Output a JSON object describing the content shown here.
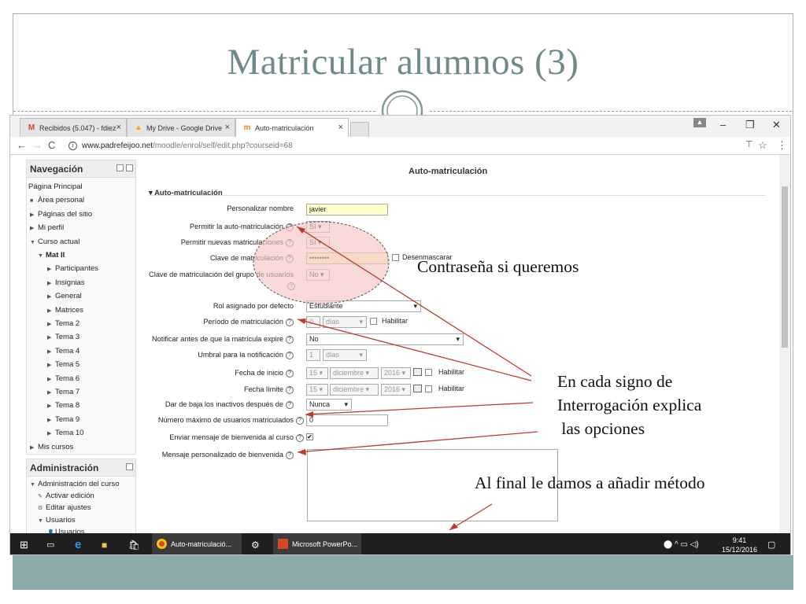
{
  "slide": {
    "title": "Matricular alumnos (3)"
  },
  "browser": {
    "tabs": [
      {
        "label": "Recibidos (5.047) - fdiez",
        "icon": "gmail-icon"
      },
      {
        "label": "My Drive - Google Drive",
        "icon": "google-drive-icon"
      },
      {
        "label": "Auto-matriculación",
        "icon": "moodle-icon",
        "active": true
      }
    ],
    "url_host": "www.padrefeijoo.net",
    "url_path": "/moodle/enrol/self/edit.php?courseid=68"
  },
  "navigation": {
    "title": "Navegación",
    "items": [
      {
        "label": "Página Principal",
        "level": 0,
        "marker": ""
      },
      {
        "label": "Área personal",
        "level": 1,
        "marker": "bullet"
      },
      {
        "label": "Páginas del sitio",
        "level": 1,
        "marker": "collapsed"
      },
      {
        "label": "Mi perfil",
        "level": 1,
        "marker": "collapsed"
      },
      {
        "label": "Curso actual",
        "level": 1,
        "marker": "expanded"
      },
      {
        "label": "Mat II",
        "level": 2,
        "marker": "expanded",
        "bold": true
      },
      {
        "label": "Participantes",
        "level": 3,
        "marker": "collapsed"
      },
      {
        "label": "Insignias",
        "level": 3,
        "marker": "collapsed"
      },
      {
        "label": "General",
        "level": 3,
        "marker": "collapsed"
      },
      {
        "label": "Matrices",
        "level": 3,
        "marker": "collapsed"
      },
      {
        "label": "Tema 2",
        "level": 3,
        "marker": "collapsed"
      },
      {
        "label": "Tema 3",
        "level": 3,
        "marker": "collapsed"
      },
      {
        "label": "Tema 4",
        "level": 3,
        "marker": "collapsed"
      },
      {
        "label": "Tema 5",
        "level": 3,
        "marker": "collapsed"
      },
      {
        "label": "Tema 6",
        "level": 3,
        "marker": "collapsed"
      },
      {
        "label": "Tema 7",
        "level": 3,
        "marker": "collapsed"
      },
      {
        "label": "Tema 8",
        "level": 3,
        "marker": "collapsed"
      },
      {
        "label": "Tema 9",
        "level": 3,
        "marker": "collapsed"
      },
      {
        "label": "Tema 10",
        "level": 3,
        "marker": "collapsed"
      },
      {
        "label": "Mis cursos",
        "level": 1,
        "marker": "collapsed"
      }
    ]
  },
  "administration": {
    "title": "Administración",
    "items": [
      {
        "label": "Administración del curso",
        "level": 1,
        "marker": "expanded"
      },
      {
        "label": "Activar edición",
        "level": 2,
        "marker": "pencil"
      },
      {
        "label": "Editar ajustes",
        "level": 2,
        "marker": "gear"
      },
      {
        "label": "Usuarios",
        "level": 2,
        "marker": "expanded"
      },
      {
        "label": "Usuarios",
        "level": 3,
        "marker": "user"
      }
    ]
  },
  "form": {
    "page_title": "Auto-matriculación",
    "section_legend": "Auto-matriculación",
    "fields": {
      "name": {
        "label": "Personalizar nombre",
        "value": "javier"
      },
      "allow_self": {
        "label": "Permitir la auto-matriculación",
        "value": "Sí"
      },
      "allow_new": {
        "label": "Permitir nuevas matriculaciones",
        "value": "Sí"
      },
      "enrol_key": {
        "label": "Clave de matriculación",
        "value": "••••••••",
        "unmask": "Desenmascarar"
      },
      "group_key": {
        "label": "Clave de matriculación del grupo de usuarios",
        "value": "No"
      },
      "role": {
        "label": "Rol asignado por defecto",
        "value": "Estudiante"
      },
      "period": {
        "label": "Período de matriculación",
        "value": "0",
        "unit": "días",
        "enable": "Habilitar"
      },
      "notify": {
        "label": "Notificar antes de que la matrícula expire",
        "value": "No"
      },
      "threshold": {
        "label": "Umbral para la notificación",
        "value": "1",
        "unit": "días"
      },
      "start_date": {
        "label": "Fecha de inicio",
        "day": "15",
        "month": "diciembre",
        "year": "2016",
        "enable": "Habilitar"
      },
      "end_date": {
        "label": "Fecha límite",
        "day": "15",
        "month": "diciembre",
        "year": "2016",
        "enable": "Habilitar"
      },
      "unenrol_inactive": {
        "label": "Dar de baja los inactivos después de",
        "value": "Nunca"
      },
      "max_users": {
        "label": "Número máximo de usuarios matriculados",
        "value": "0"
      },
      "welcome": {
        "label": "Enviar mensaje de bienvenida al curso",
        "checked": true
      },
      "welcome_msg": {
        "label": "Mensaje personalizado de bienvenida",
        "value": ""
      }
    }
  },
  "taskbar": {
    "apps": [
      {
        "label": "Auto-matriculació...",
        "icon": "chrome-icon"
      },
      {
        "label": "Microsoft PowerPo...",
        "icon": "powerpoint-icon"
      }
    ],
    "time": "9:41",
    "date": "15/12/2016"
  },
  "annotations": {
    "password": "Contraseña si queremos",
    "line1": "En cada signo de",
    "line2": "Interrogación explica",
    "line3": " las opciones",
    "final": "Al final le damos a añadir método"
  },
  "colors": {
    "title": "#6f8a8a",
    "accent_band": "#8eabab",
    "highlight_circle": "#f4c7c3",
    "arrow": "#c0392b"
  }
}
